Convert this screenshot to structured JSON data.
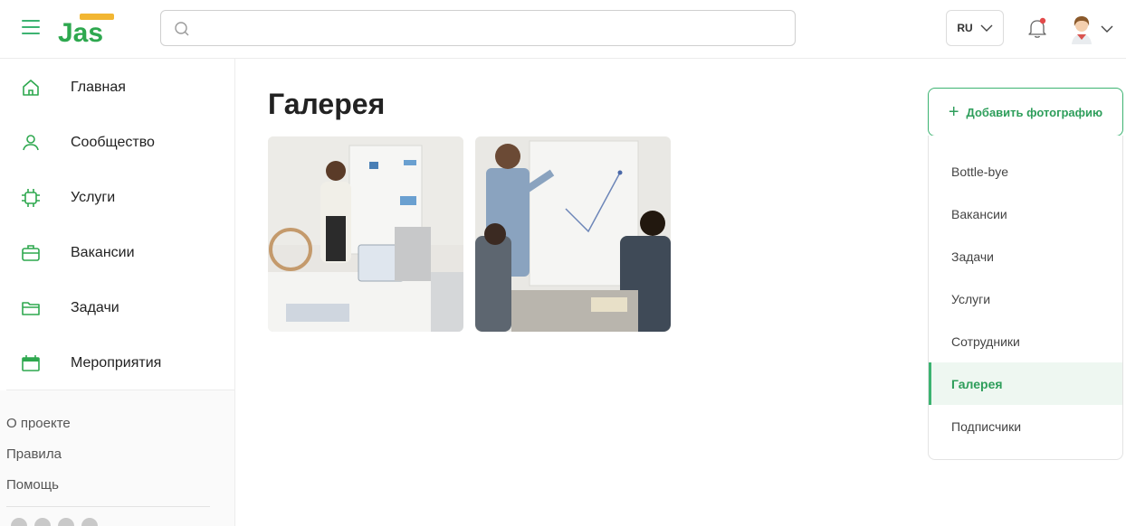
{
  "header": {
    "search_placeholder": "",
    "lang": "RU",
    "notification_badge_color": "#e24a4a",
    "accent_color": "#3cb371"
  },
  "sidebar": {
    "items": [
      {
        "label": "Главная",
        "icon": "home-icon"
      },
      {
        "label": "Сообщество",
        "icon": "user-icon"
      },
      {
        "label": "Услуги",
        "icon": "chip-icon"
      },
      {
        "label": "Вакансии",
        "icon": "briefcase-icon"
      },
      {
        "label": "Задачи",
        "icon": "folder-icon"
      },
      {
        "label": "Мероприятия",
        "icon": "calendar-icon"
      }
    ],
    "links": [
      "О проекте",
      "Правила",
      "Помощь"
    ]
  },
  "main": {
    "title": "Галерея",
    "photos": [
      {
        "alt": "presentation-photo-1"
      },
      {
        "alt": "presentation-photo-2"
      }
    ]
  },
  "right": {
    "add_label": "Добавить фотографию",
    "categories": [
      "Bottle-bye",
      "Вакансии",
      "Задачи",
      "Услуги",
      "Сотрудники",
      "Галерея",
      "Подписчики"
    ],
    "active_category": "Галерея"
  }
}
